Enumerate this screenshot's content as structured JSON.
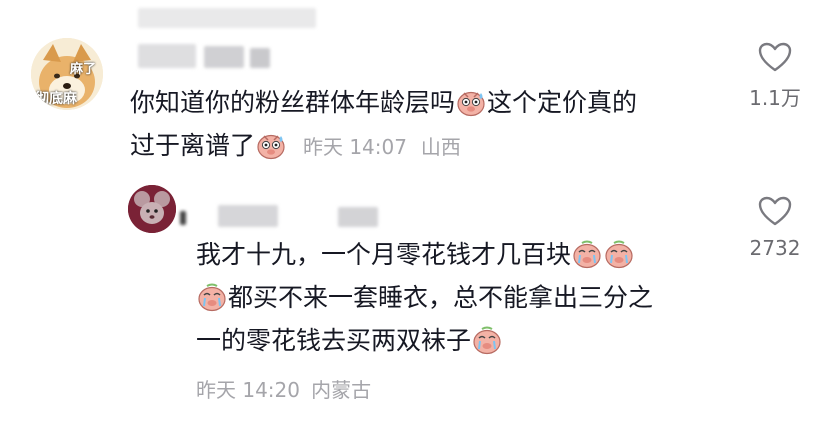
{
  "comments": [
    {
      "username": "",
      "avatar_caption": [
        "麻了",
        "彻底麻"
      ],
      "text_line1_a": "你知道你的粉丝群体年龄层吗",
      "text_line1_b": "这个定价真的",
      "text_line2": "过于离谱了",
      "time": "昨天 14:07",
      "location": "山西",
      "like_count": "1.1万",
      "like_icon": "heart-outline-icon",
      "emoji_icon": "pig-sweat-emoji"
    },
    {
      "username": "",
      "text_line1": "我才十九，一个月零花钱才几百块",
      "text_line2": "都买不来一套睡衣，总不能拿出三分之",
      "text_line3": "一的零花钱去买两双袜子",
      "time": "昨天 14:20",
      "location": "内蒙古",
      "like_count": "2732",
      "like_icon": "heart-outline-icon",
      "emoji_icon": "pig-cry-emoji"
    }
  ],
  "colors": {
    "text": "#161823",
    "meta": "#a5a5aa",
    "blur": "#e9e9ea",
    "emoji_face": "#f3b2a6"
  }
}
